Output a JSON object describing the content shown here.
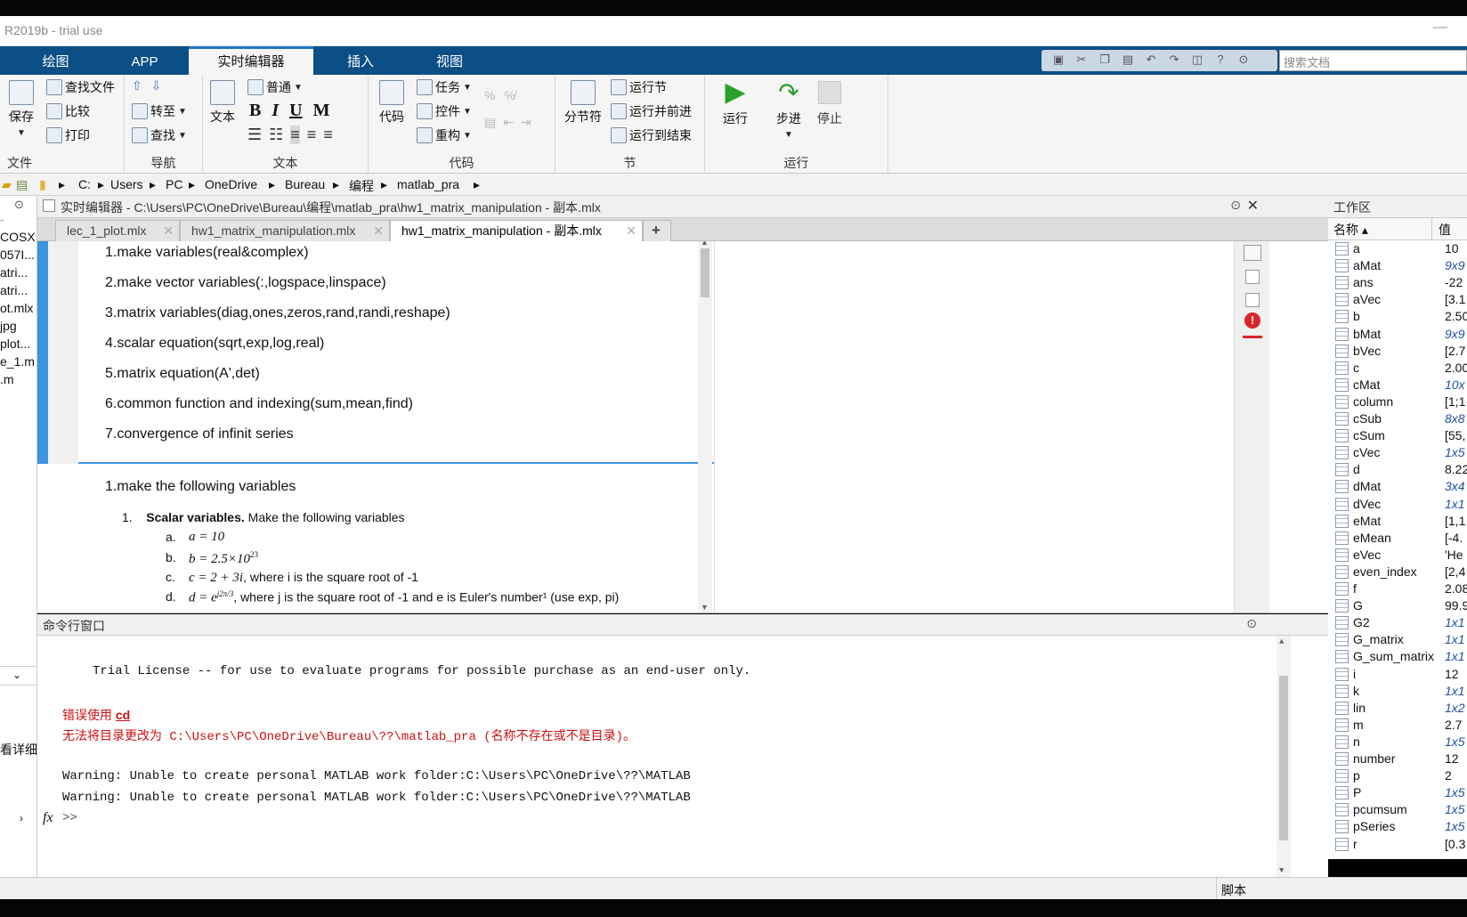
{
  "window": {
    "title": "R2019b - trial use",
    "minimize": "—"
  },
  "ribbon_tabs": [
    "绘图",
    "APP",
    "实时编辑器",
    "插入",
    "视图"
  ],
  "search": {
    "placeholder": "搜索文档"
  },
  "ribbon": {
    "file": {
      "save": "保存",
      "find_files": "查找文件",
      "compare": "比较",
      "print": "打印",
      "label": "文件"
    },
    "nav": {
      "goto": "转至",
      "find": "查找",
      "label": "导航"
    },
    "text": {
      "text_btn": "文本",
      "style": "普通",
      "bold": "B",
      "italic": "I",
      "underline": "U",
      "mono": "M",
      "label": "文本"
    },
    "code": {
      "code_btn": "代码",
      "task": "任务",
      "control": "控件",
      "refactor": "重构",
      "label": "代码"
    },
    "section": {
      "break": "分节符",
      "run_section": "运行节",
      "run_advance": "运行并前进",
      "run_to_end": "运行到结束",
      "label": "节"
    },
    "run": {
      "run": "运行",
      "step": "步进",
      "stop": "停止",
      "label": "运行"
    }
  },
  "address": [
    "C:",
    "Users",
    "PC",
    "OneDrive",
    "Bureau",
    "编程",
    "matlab_pra"
  ],
  "left_files": [
    "COSX",
    "057I...",
    "atri...",
    "atri...",
    "ot.mlx",
    "jpg",
    "plot...",
    "e_1.m",
    ".m"
  ],
  "left_bottom_text": "看详细",
  "editor": {
    "header": "实时编辑器 - C:\\Users\\PC\\OneDrive\\Bureau\\编程\\matlab_pra\\hw1_matrix_manipulation - 副本.mlx",
    "tabs": [
      "lec_1_plot.mlx",
      "hw1_matrix_manipulation.mlx",
      "hw1_matrix_manipulation - 副本.mlx"
    ],
    "add_tab": "+",
    "toc": [
      "1.make variables(real&complex)",
      "2.make vector variables(:,logspace,linspace)",
      "3.matrix variables(diag,ones,zeros,rand,randi,reshape)",
      "4.scalar equation(sqrt,exp,log,real)",
      "5.matrix equation(A',det)",
      "6.common function and indexing(sum,mean,find)",
      "7.convergence of infinit series"
    ],
    "section_title": "1.make the following variables",
    "problem": {
      "num": "1.",
      "bold": "Scalar variables.",
      "rest": " Make the following variables",
      "items": [
        {
          "letter": "a.",
          "expr": "a = 10",
          "note": ""
        },
        {
          "letter": "b.",
          "expr": "b = 2.5×10",
          "sup": "23",
          "note": ""
        },
        {
          "letter": "c.",
          "expr": "c = 2 + 3i",
          "note": ", where  i  is the square root of -1"
        },
        {
          "letter": "d.",
          "expr": "d = e",
          "sup": "j2π/3",
          "note": ", where  j  is the square root of -1 and  e  is Euler's number¹ (use exp, pi)"
        }
      ]
    }
  },
  "command": {
    "header": "命令行窗口",
    "license": "Trial License -- for use to evaluate programs for possible purchase as an end-user only.",
    "err1_prefix": "错误使用 ",
    "err1_link": "cd",
    "err2": "无法将目录更改为 C:\\Users\\PC\\OneDrive\\Bureau\\??\\matlab_pra (名称不存在或不是目录)。",
    "warn1": "Warning: Unable to create personal MATLAB work folder:C:\\Users\\PC\\OneDrive\\??\\MATLAB",
    "warn2": "Warning: Unable to create personal MATLAB work folder:C:\\Users\\PC\\OneDrive\\??\\MATLAB",
    "fx": "fx",
    "prompt": ">>"
  },
  "workspace": {
    "header": "工作区",
    "col_name": "名称 ▴",
    "col_value": "值",
    "rows": [
      {
        "n": "a",
        "v": "10",
        "it": false
      },
      {
        "n": "aMat",
        "v": "9x9",
        "it": true
      },
      {
        "n": "ans",
        "v": "-22",
        "it": false
      },
      {
        "n": "aVec",
        "v": "[3.1",
        "it": false
      },
      {
        "n": "b",
        "v": "2.50",
        "it": false
      },
      {
        "n": "bMat",
        "v": "9x9",
        "it": true
      },
      {
        "n": "bVec",
        "v": "[2.7",
        "it": false
      },
      {
        "n": "c",
        "v": "2.00",
        "it": false
      },
      {
        "n": "cMat",
        "v": "10x",
        "it": true
      },
      {
        "n": "column",
        "v": "[1;1",
        "it": false
      },
      {
        "n": "cSub",
        "v": "8x8",
        "it": true
      },
      {
        "n": "cSum",
        "v": "[55,",
        "it": false
      },
      {
        "n": "cVec",
        "v": "1x5",
        "it": true
      },
      {
        "n": "d",
        "v": "8.22",
        "it": false
      },
      {
        "n": "dMat",
        "v": "3x4",
        "it": true
      },
      {
        "n": "dVec",
        "v": "1x1",
        "it": true
      },
      {
        "n": "eMat",
        "v": "[1,1",
        "it": false
      },
      {
        "n": "eMean",
        "v": "[-4.",
        "it": false
      },
      {
        "n": "eVec",
        "v": "'He",
        "it": false
      },
      {
        "n": "even_index",
        "v": "[2,4",
        "it": false
      },
      {
        "n": "f",
        "v": "2.08",
        "it": false
      },
      {
        "n": "G",
        "v": "99.9",
        "it": false
      },
      {
        "n": "G2",
        "v": "1x1",
        "it": true
      },
      {
        "n": "G_matrix",
        "v": "1x1",
        "it": true
      },
      {
        "n": "G_sum_matrix",
        "v": "1x1",
        "it": true
      },
      {
        "n": "i",
        "v": "12",
        "it": false
      },
      {
        "n": "k",
        "v": "1x1",
        "it": true
      },
      {
        "n": "lin",
        "v": "1x2",
        "it": true
      },
      {
        "n": "m",
        "v": "2.7",
        "it": false
      },
      {
        "n": "n",
        "v": "1x5",
        "it": true
      },
      {
        "n": "number",
        "v": "12",
        "it": false
      },
      {
        "n": "p",
        "v": "2",
        "it": false
      },
      {
        "n": "P",
        "v": "1x5",
        "it": true
      },
      {
        "n": "pcumsum",
        "v": "1x5",
        "it": true
      },
      {
        "n": "pSeries",
        "v": "1x5",
        "it": true
      },
      {
        "n": "r",
        "v": "[0.3",
        "it": false
      }
    ]
  },
  "status": {
    "mode": "脚本"
  }
}
